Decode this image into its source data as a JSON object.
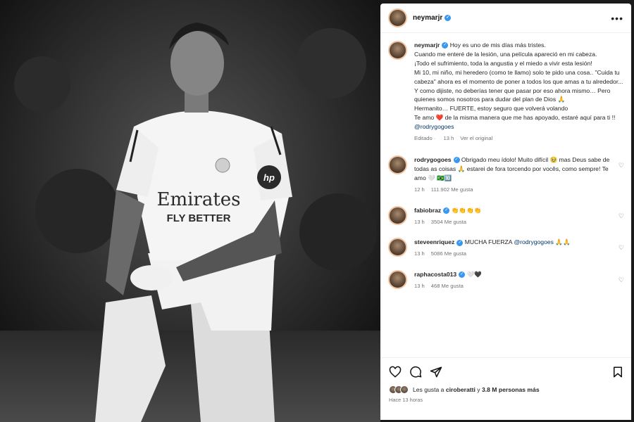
{
  "post": {
    "author": "neymarjr",
    "more_label": "•••",
    "caption_lines": [
      "Hoy es uno de mis días más tristes.",
      "Cuando me enteré de la lesión, una película apareció en mi cabeza.",
      "¡Todo el sufrimiento, toda la angustia y el miedo a vivir esta lesión!",
      "Mi 10, mi niño, mi heredero (como te llamo) solo te pido una cosa.. \"Cuida tu cabeza\" ahora es el momento de poner a todos los que amas a tu alrededor...",
      "Y como dijiste, no deberías tener que pasar por eso ahora mismo… Pero quienes somos nosotros para dudar del plan de Dios 🙏",
      "Hermanito… FUERTE, estoy seguro que volverá volando",
      "Te amo ❤️ de la misma manera que me has apoyado, estaré aquí para ti !!"
    ],
    "caption_mention": "@rodrygogoes",
    "edited_label": "Editado",
    "time_ago": "13 h",
    "see_original": "Ver el original"
  },
  "comments": [
    {
      "user": "rodrygogoes",
      "text": "Obrigado meu ídolo! Muito difícil 🥹 mas Deus sabe de todas as coisas 🙏 estarei de fora torcendo por vocês, como sempre! Te amo 🤍 🇧🇷🔟",
      "time": "12 h",
      "likes": "111.902 Me gusta"
    },
    {
      "user": "fabiobraz",
      "text": "👏👏👏👏",
      "time": "13 h",
      "likes": "3504 Me gusta"
    },
    {
      "user": "steveenriquez",
      "text": "MUCHA FUERZA",
      "mention": "@rodrygogoes",
      "text_tail": "🙏🙏",
      "time": "13 h",
      "likes": "5086 Me gusta"
    },
    {
      "user": "raphacosta013",
      "text": "🤍🖤",
      "time": "13 h",
      "likes": "468 Me gusta"
    }
  ],
  "footer": {
    "likes_prefix": "Les gusta a",
    "likes_user": "ciroberatti",
    "likes_mid": "y",
    "likes_count": "3.8 M personas más",
    "posted_ago": "Hace 13 horas"
  },
  "photo": {
    "shirt_brand": "Emirates",
    "shirt_sub": "FLY BETTER",
    "sponsor_badge": "hp"
  },
  "colors": {
    "verified": "#3897f0",
    "mention": "#00376b",
    "muted": "#737373"
  }
}
